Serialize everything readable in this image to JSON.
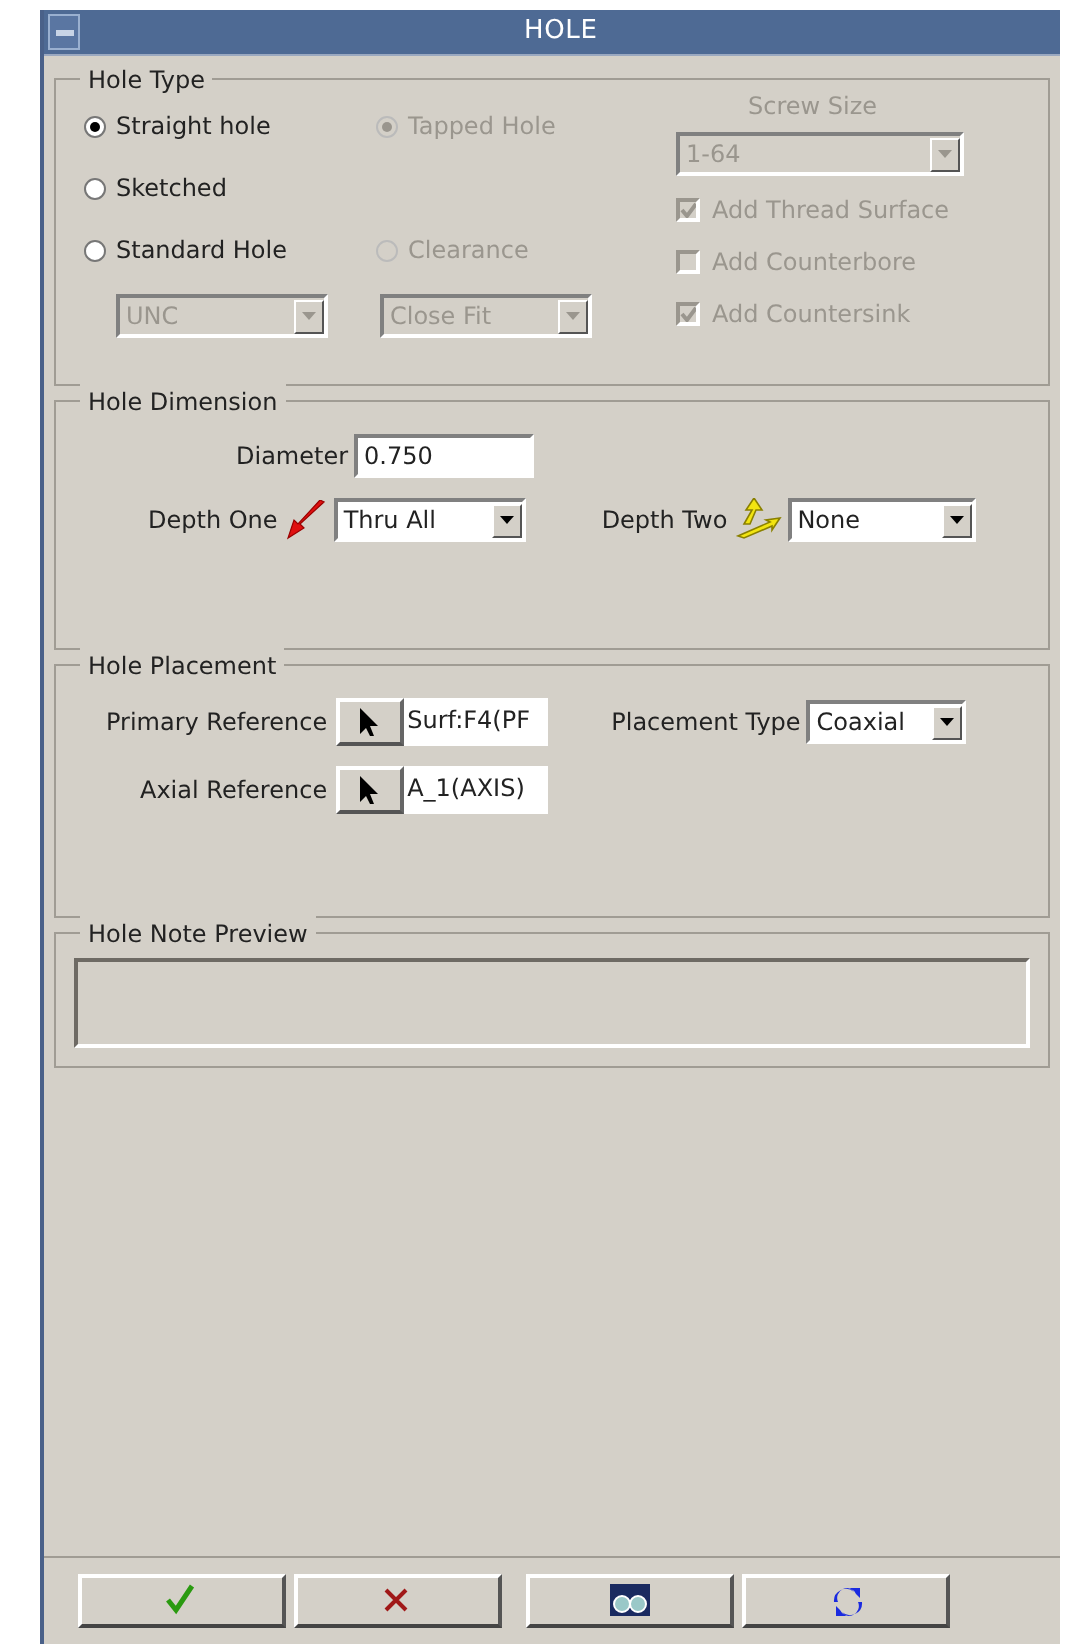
{
  "window": {
    "title": "HOLE"
  },
  "hole_type": {
    "legend": "Hole Type",
    "column_1": [
      {
        "kind": "radio",
        "label": "Straight hole",
        "selected": true,
        "disabled": false
      },
      {
        "kind": "radio",
        "label": "Sketched",
        "selected": false,
        "disabled": false
      },
      {
        "kind": "radio",
        "label": "Standard Hole",
        "selected": false,
        "disabled": false
      },
      {
        "kind": "dropdown",
        "value": "UNC",
        "disabled": true
      }
    ],
    "column_2": [
      {
        "kind": "radio",
        "label": "Tapped Hole",
        "selected": true,
        "disabled": true
      },
      {
        "kind": "radio",
        "label": "Clearance",
        "selected": false,
        "disabled": true
      },
      {
        "kind": "dropdown",
        "value": "Close Fit",
        "disabled": true
      }
    ],
    "screw_size": {
      "label": "Screw Size",
      "value": "1-64",
      "disabled": true
    },
    "options": [
      {
        "label": "Add Thread Surface",
        "checked": true,
        "disabled": true
      },
      {
        "label": "Add Counterbore",
        "checked": false,
        "disabled": true
      },
      {
        "label": "Add Countersink",
        "checked": true,
        "disabled": true
      }
    ]
  },
  "hole_dimension": {
    "legend": "Hole Dimension",
    "diameter": {
      "label": "Diameter",
      "value": "0.750"
    },
    "depth_one": {
      "label": "Depth One",
      "value": "Thru All"
    },
    "depth_two": {
      "label": "Depth Two",
      "value": "None"
    }
  },
  "hole_placement": {
    "legend": "Hole Placement",
    "primary_reference": {
      "label": "Primary Reference",
      "value": "Surf:F4(PF"
    },
    "axial_reference": {
      "label": "Axial Reference",
      "value": "A_1(AXIS)"
    },
    "placement_type": {
      "label": "Placement Type",
      "value": "Coaxial"
    }
  },
  "hole_note_preview": {
    "legend": "Hole Note Preview"
  },
  "buttons": [
    {
      "kind": "ok"
    },
    {
      "kind": "cancel"
    },
    {
      "kind": "preview"
    },
    {
      "kind": "repaint"
    }
  ]
}
